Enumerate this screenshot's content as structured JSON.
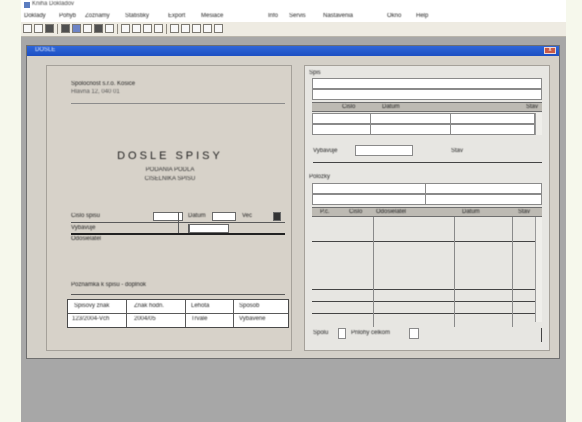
{
  "window": {
    "title": "Kniha Dokladov"
  },
  "menu": {
    "items": [
      "Doklady",
      "Pohyb",
      "Zoznamy",
      "Statistiky",
      "Export",
      "Mesiace",
      "Info",
      "Servis",
      "Nastavenia",
      "Okno",
      "Help"
    ]
  },
  "document": {
    "title": "DOSLE",
    "close_glyph": "x",
    "company_line1": "Spolocnost s.r.o. Kosice",
    "company_line2": "Hlavna 12, 040 01",
    "heading": "DOSLE  SPISY",
    "subline1": "PODANIA  PODLA",
    "subline2": "CISELNIKA  SPISU",
    "form": {
      "label_cislo": "Cislo spisu",
      "label_datum": "Datum",
      "label_vec": "Vec",
      "checkbox": "",
      "value_cislo": "",
      "value_datum": "",
      "row2_label": "Vybavuje",
      "row2_value": "",
      "row3_label": "Odosielatel"
    },
    "bottom_label": "Poznamka  k  spisu  -  doplnok",
    "footer_table": {
      "headers": [
        "Spisovy znak",
        "Znak hodn.",
        "Lehota",
        "Sposob"
      ],
      "values": [
        "123/2004-Vch",
        "2004/05",
        "Trvale",
        "Vybavene"
      ]
    }
  },
  "right": {
    "label_spis": "Spis",
    "grid1": {
      "headers": [
        "",
        "Cislo",
        "Datum",
        "",
        "Stav"
      ]
    },
    "label_vybav": "Vybavuje",
    "label_stav": "Stav",
    "label_polozky": "Polozky",
    "grid2": {
      "headers": [
        "P.c.",
        "Cislo",
        "Odosielatel",
        "Datum",
        "Stav"
      ]
    },
    "bottom_label": "Spolu",
    "bottom_label2": "Prilohy celkom"
  }
}
